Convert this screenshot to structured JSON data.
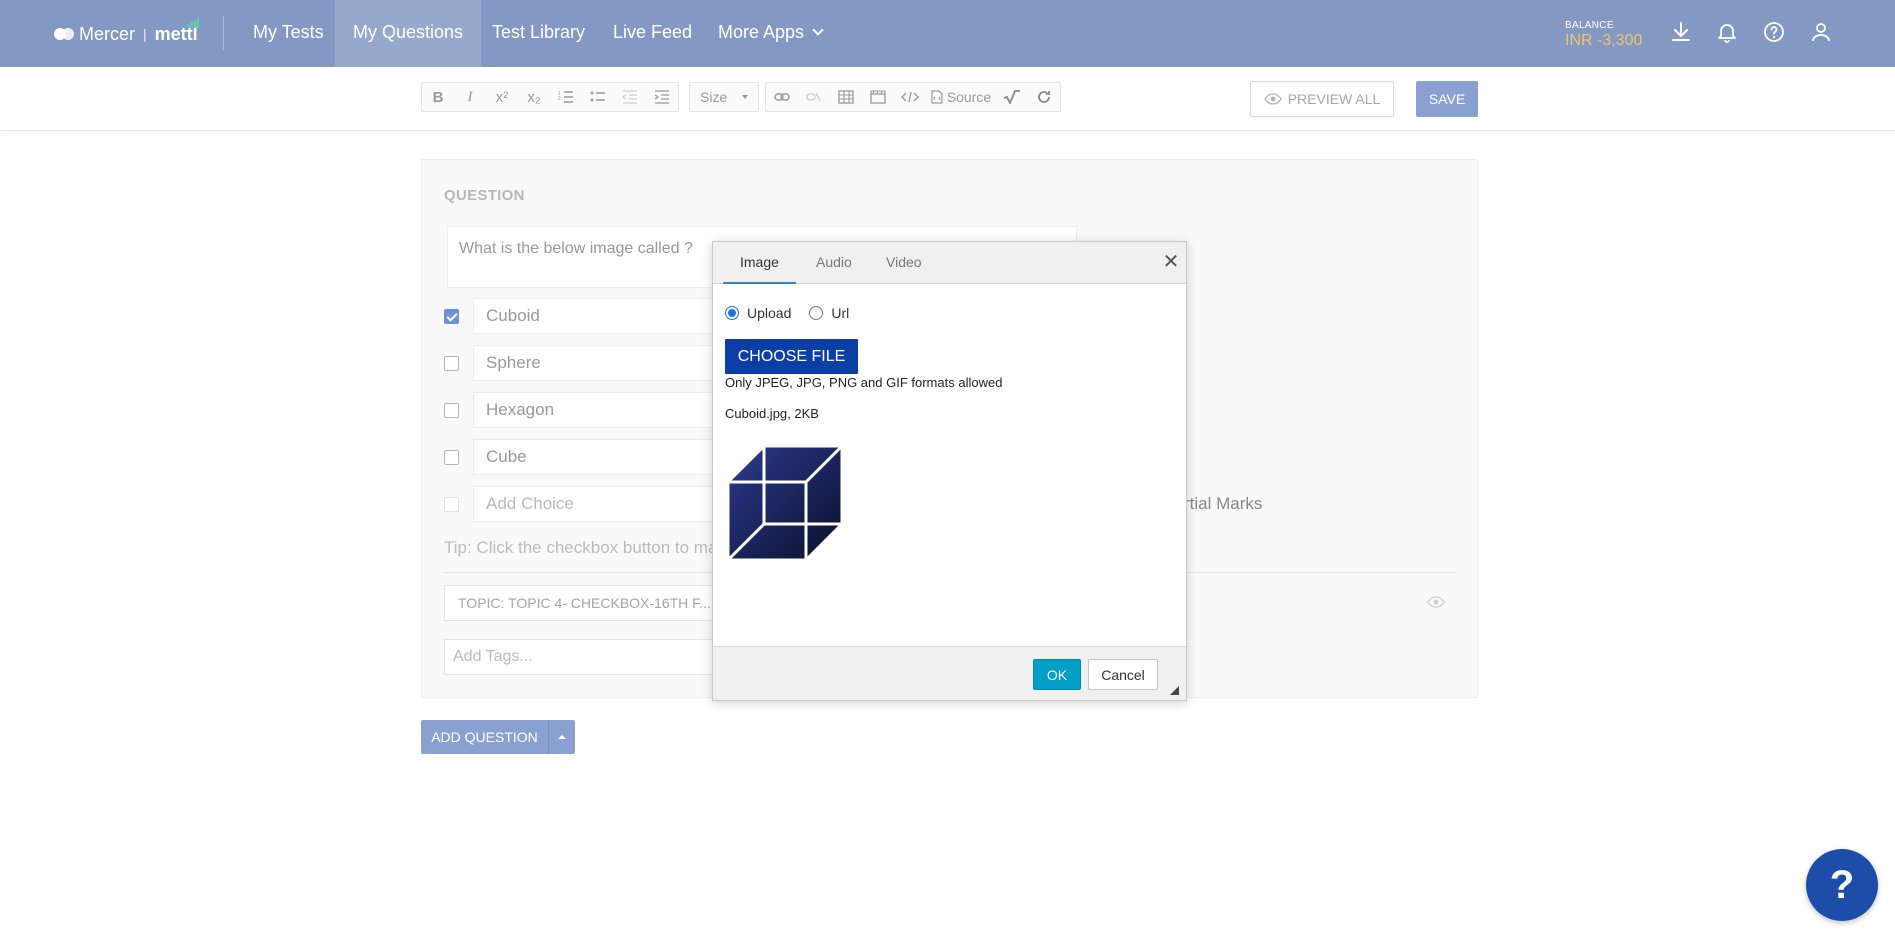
{
  "brand": {
    "mercer": "Mercer",
    "separator": "|",
    "mettl": "mettl"
  },
  "nav": {
    "items": [
      {
        "label": "My Tests"
      },
      {
        "label": "My Questions"
      },
      {
        "label": "Test Library"
      },
      {
        "label": "Live Feed"
      },
      {
        "label": "More Apps"
      }
    ],
    "active": "My Questions"
  },
  "balance": {
    "label": "BALANCE",
    "value": "INR -3,300"
  },
  "header_icons": [
    "download-icon",
    "bell-icon",
    "help-circle-icon",
    "user-icon"
  ],
  "toolbar": {
    "size_label": "Size",
    "source_label": "Source",
    "preview_all": "PREVIEW ALL",
    "save": "SAVE"
  },
  "question": {
    "section_label": "QUESTION",
    "text": "What is the below image called ?",
    "choices": [
      {
        "text": "Cuboid",
        "checked": true
      },
      {
        "text": "Sphere",
        "checked": false
      },
      {
        "text": "Hexagon",
        "checked": false
      },
      {
        "text": "Cube",
        "checked": false
      }
    ],
    "add_choice_placeholder": "Add Choice",
    "partial_marks": "rtial Marks",
    "tip": "Tip: Click the checkbox button to ma",
    "topic": "TOPIC: TOPIC 4- CHECKBOX-16TH F...",
    "tags_placeholder": "Add Tags..."
  },
  "add_question": "ADD QUESTION",
  "dialog": {
    "tabs": [
      "Image",
      "Audio",
      "Video"
    ],
    "active_tab": "Image",
    "source_options": [
      "Upload",
      "Url"
    ],
    "selected_source": "Upload",
    "choose_file": "CHOOSE FILE",
    "formats_note": "Only JPEG, JPG, PNG and GIF formats allowed",
    "file_info": "Cuboid.jpg, 2KB",
    "ok": "OK",
    "cancel": "Cancel"
  },
  "help_button": "?",
  "colors": {
    "nav_bg": "#8399c3",
    "primary_btn": "#8aa0d0",
    "choose_file_bg": "#0b3fa6",
    "ok_bg": "#00a0c6",
    "balance_value": "#f0c36d",
    "help_bg": "#1c4da8"
  }
}
